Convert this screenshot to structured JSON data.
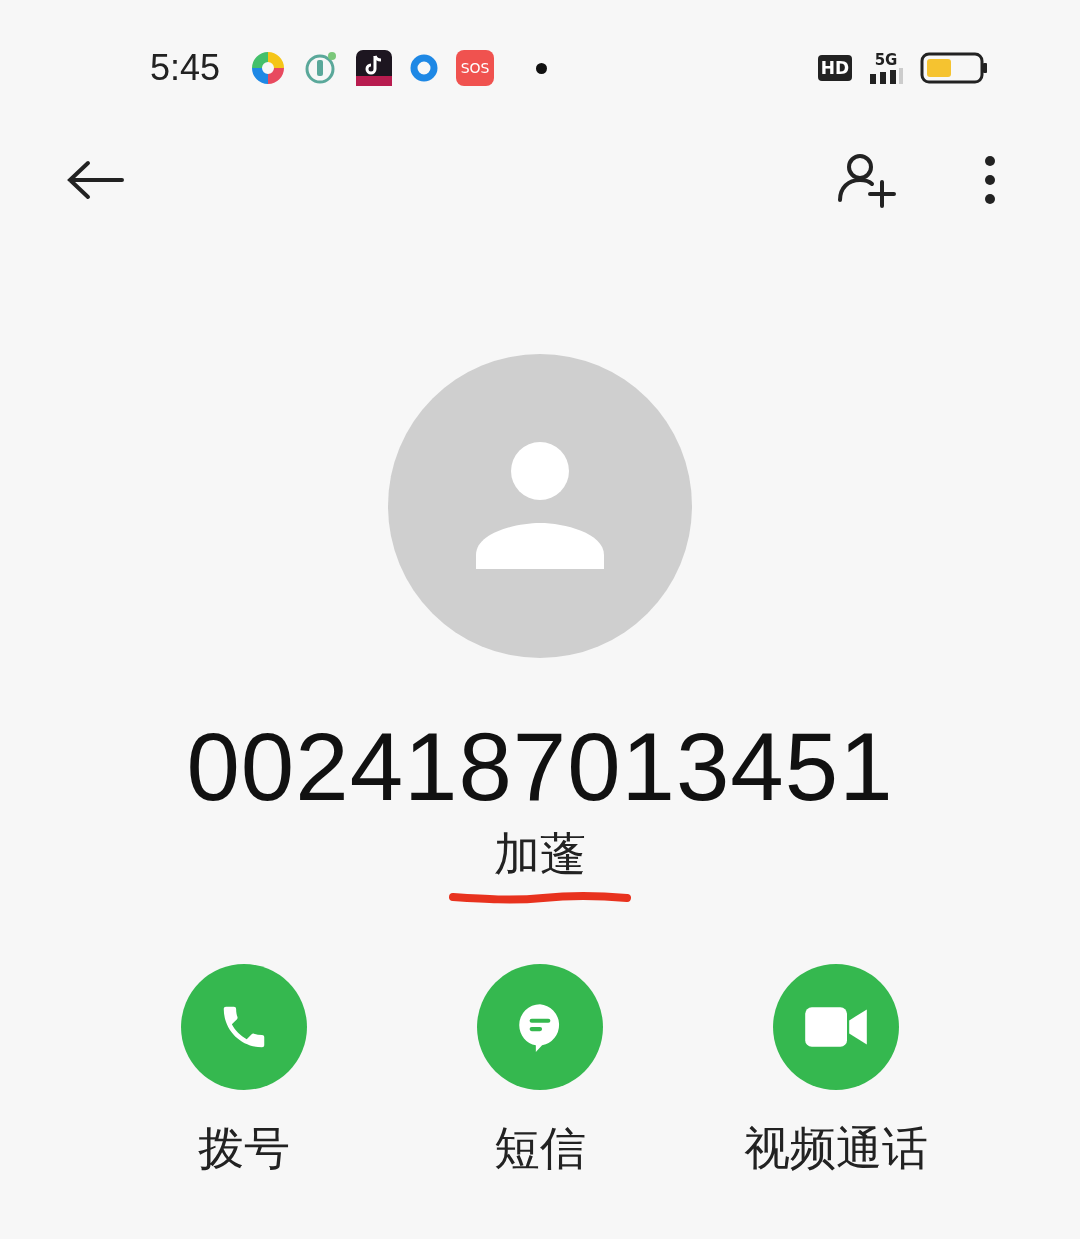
{
  "status_bar": {
    "time": "5:45",
    "sos_label": "SOS",
    "hd_label": "HD",
    "network": "5G"
  },
  "contact": {
    "number": "0024187013451",
    "location": "加蓬",
    "location_underlined": true
  },
  "actions": [
    {
      "kind": "call",
      "label": "拨号"
    },
    {
      "kind": "message",
      "label": "短信"
    },
    {
      "kind": "video",
      "label": "视频通话"
    }
  ]
}
